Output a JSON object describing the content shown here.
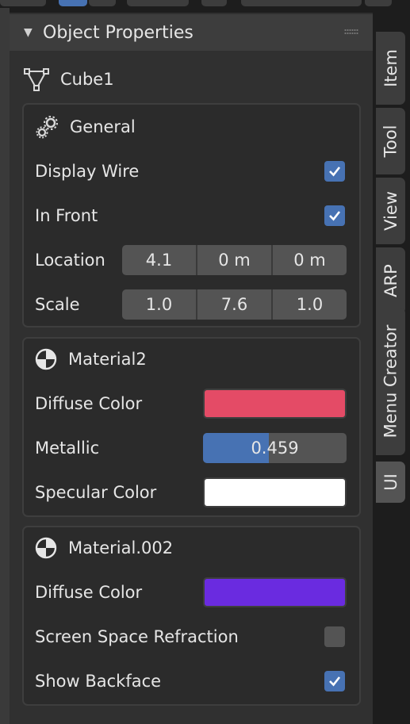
{
  "panel": {
    "title": "Object Properties",
    "object_name": "Cube1"
  },
  "general": {
    "title": "General",
    "display_wire": {
      "label": "Display Wire",
      "checked": true
    },
    "in_front": {
      "label": "In Front",
      "checked": true
    },
    "location": {
      "label": "Location",
      "values": [
        "4.1",
        "0 m",
        "0 m"
      ]
    },
    "scale": {
      "label": "Scale",
      "values": [
        "1.0",
        "7.6",
        "1.0"
      ]
    }
  },
  "material2": {
    "title": "Material2",
    "diffuse": {
      "label": "Diffuse Color",
      "color": "#e44b66"
    },
    "metallic": {
      "label": "Metallic",
      "value": "0.459",
      "fraction": 0.459
    },
    "specular": {
      "label": "Specular Color",
      "color": "#ffffff"
    }
  },
  "material002": {
    "title": "Material.002",
    "diffuse": {
      "label": "Diffuse Color",
      "color": "#6a2be0"
    },
    "ssr": {
      "label": "Screen Space Refraction",
      "checked": false
    },
    "backface": {
      "label": "Show Backface",
      "checked": true
    }
  },
  "tabs": [
    "Item",
    "Tool",
    "View",
    "ARP",
    "Menu Creator",
    "UI"
  ],
  "colors": {
    "accent": "#4772b3",
    "panel": "#303030",
    "field": "#545454"
  },
  "icons": {
    "header_arrow": "triangle-down-icon",
    "object": "mesh-triangle-icon",
    "general": "gears-icon",
    "material": "material-sphere-icon",
    "check": "checkmark-icon"
  }
}
